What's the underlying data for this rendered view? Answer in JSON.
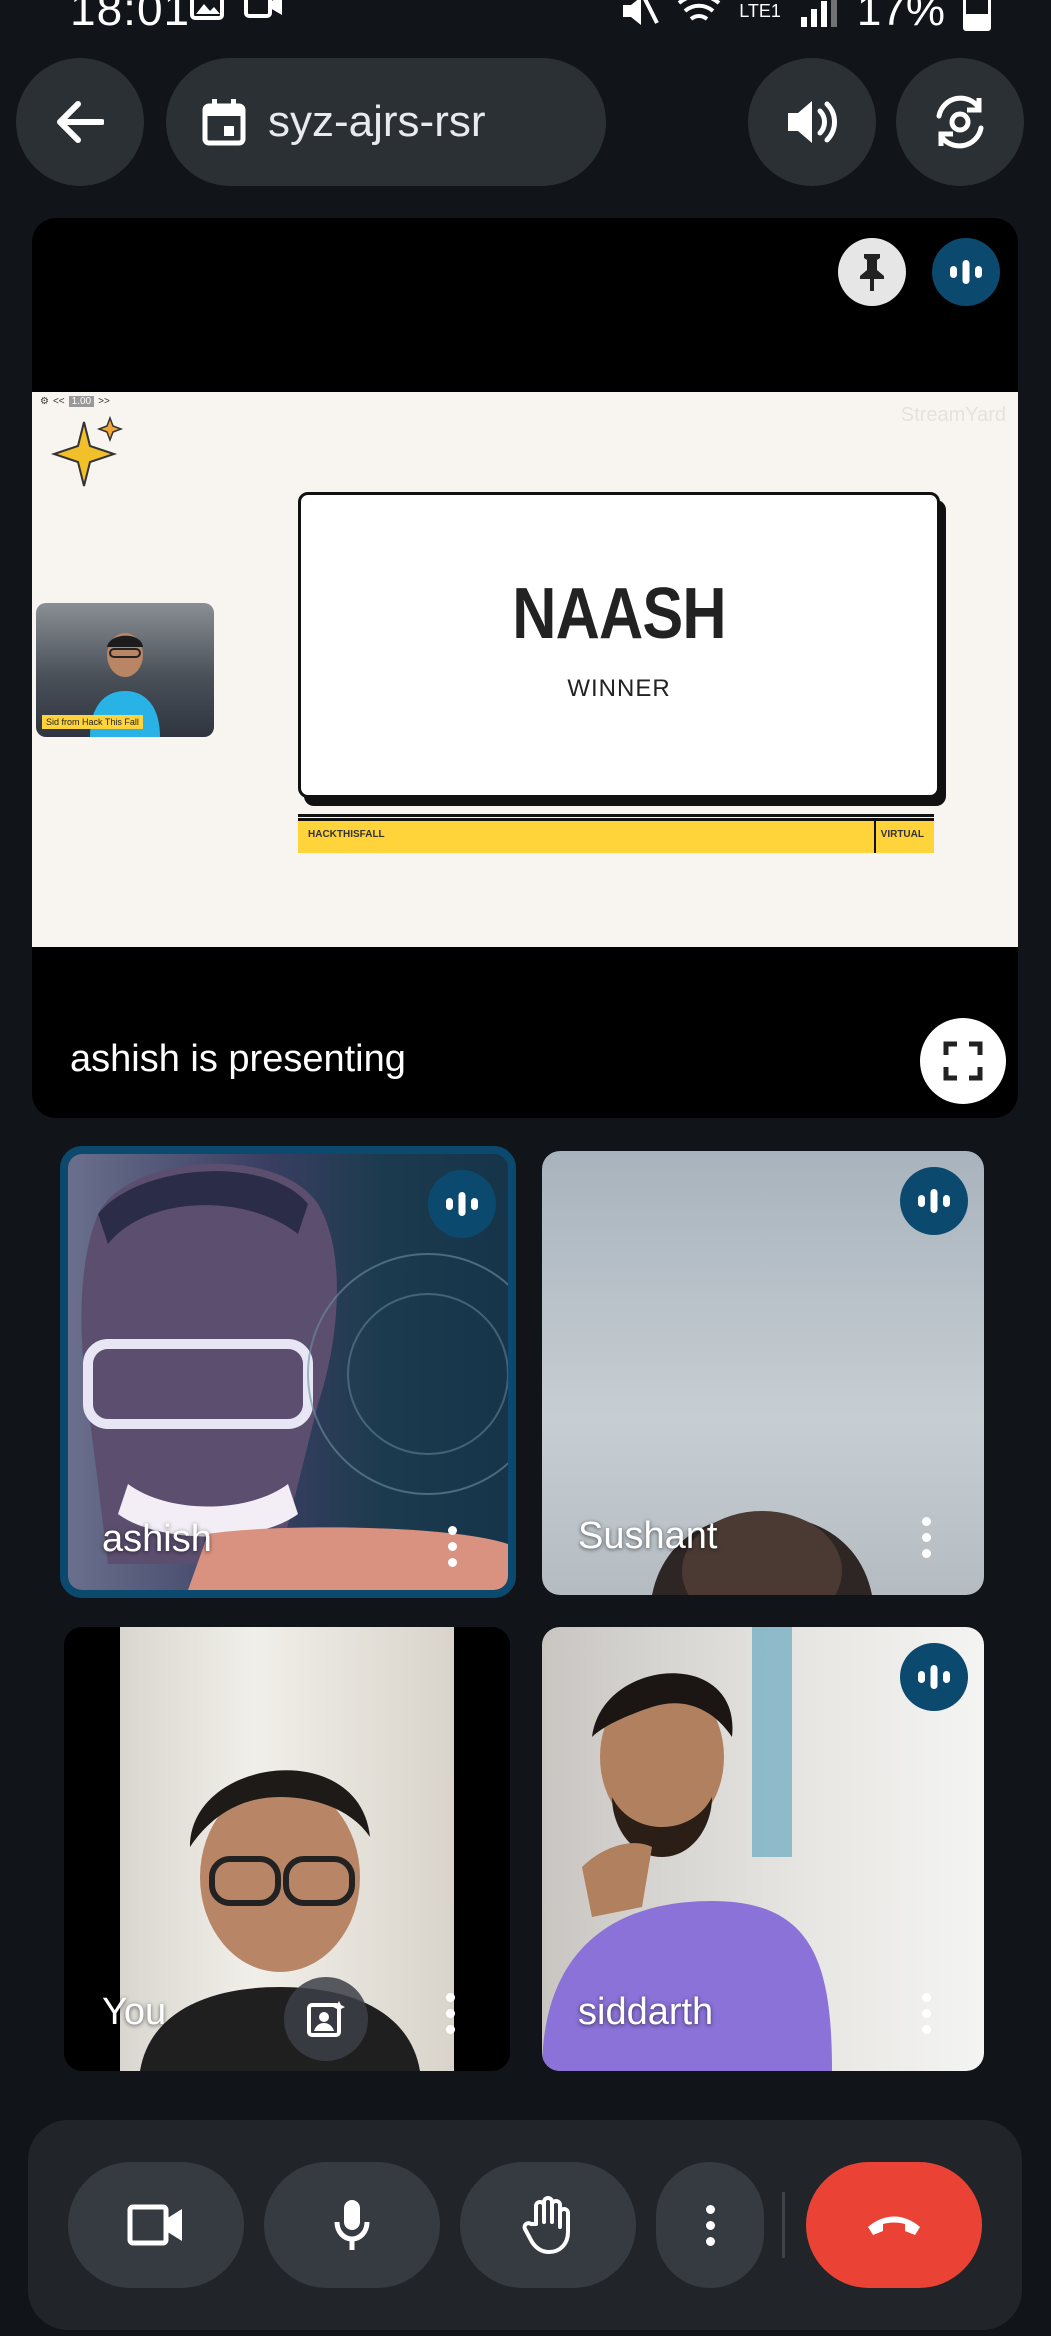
{
  "status_bar": {
    "time": "18:01",
    "battery": "17%",
    "network": "LTE1"
  },
  "header": {
    "meeting_code": "syz-ajrs-rsr"
  },
  "presentation": {
    "presenter_label": "ashish is presenting",
    "slide": {
      "title": "NAASH",
      "subtitle": "WINNER",
      "bar_left": "HACKTHISFALL",
      "bar_right": "VIRTUAL",
      "watermark": "StreamYard",
      "pip_caption": "Sid from Hack This Fall",
      "mini_controls": "1.00"
    }
  },
  "participants": [
    {
      "name": "ashish",
      "speaking": true,
      "active": true
    },
    {
      "name": "Sushant",
      "speaking": true,
      "active": false
    },
    {
      "name": "You",
      "speaking": false,
      "active": false
    },
    {
      "name": "siddarth",
      "speaking": true,
      "active": false
    }
  ],
  "colors": {
    "end_call": "#ea4335",
    "speaking_badge": "#0b4a6e",
    "active_border": "#0b4a6e"
  }
}
